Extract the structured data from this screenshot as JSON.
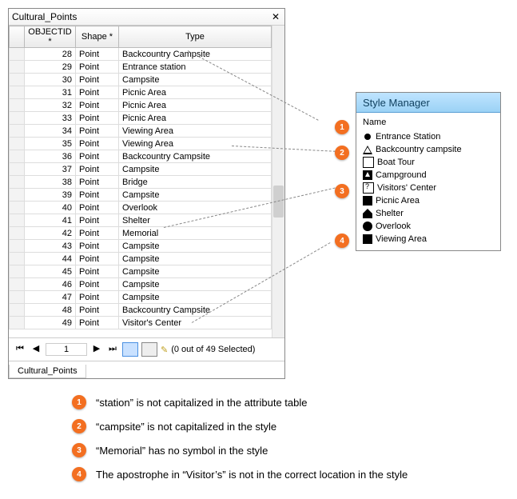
{
  "attrTable": {
    "title": "Cultural_Points",
    "tabLabel": "Cultural_Points",
    "columns": [
      "OBJECTID *",
      "Shape *",
      "Type"
    ],
    "rows": [
      {
        "oid": 28,
        "shape": "Point",
        "type": "Backcountry Campsite"
      },
      {
        "oid": 29,
        "shape": "Point",
        "type": "Entrance station"
      },
      {
        "oid": 30,
        "shape": "Point",
        "type": "Campsite"
      },
      {
        "oid": 31,
        "shape": "Point",
        "type": "Picnic Area"
      },
      {
        "oid": 32,
        "shape": "Point",
        "type": "Picnic Area"
      },
      {
        "oid": 33,
        "shape": "Point",
        "type": "Picnic Area"
      },
      {
        "oid": 34,
        "shape": "Point",
        "type": "Viewing Area"
      },
      {
        "oid": 35,
        "shape": "Point",
        "type": "Viewing Area"
      },
      {
        "oid": 36,
        "shape": "Point",
        "type": "Backcountry Campsite"
      },
      {
        "oid": 37,
        "shape": "Point",
        "type": "Campsite"
      },
      {
        "oid": 38,
        "shape": "Point",
        "type": "Bridge"
      },
      {
        "oid": 39,
        "shape": "Point",
        "type": "Campsite"
      },
      {
        "oid": 40,
        "shape": "Point",
        "type": "Overlook"
      },
      {
        "oid": 41,
        "shape": "Point",
        "type": "Shelter"
      },
      {
        "oid": 42,
        "shape": "Point",
        "type": "Memorial"
      },
      {
        "oid": 43,
        "shape": "Point",
        "type": "Campsite"
      },
      {
        "oid": 44,
        "shape": "Point",
        "type": "Campsite"
      },
      {
        "oid": 45,
        "shape": "Point",
        "type": "Campsite"
      },
      {
        "oid": 46,
        "shape": "Point",
        "type": "Campsite"
      },
      {
        "oid": 47,
        "shape": "Point",
        "type": "Campsite"
      },
      {
        "oid": 48,
        "shape": "Point",
        "type": "Backcountry Campsite"
      },
      {
        "oid": 49,
        "shape": "Point",
        "type": "Visitor's Center"
      }
    ],
    "nav": {
      "first": "⏮",
      "prev": "◀",
      "record": "1",
      "next": "▶",
      "last": "⏭",
      "status": "(0 out of 49 Selected)"
    }
  },
  "styleManager": {
    "title": "Style Manager",
    "header": "Name",
    "items": [
      {
        "sym": "dot",
        "label": "Entrance Station"
      },
      {
        "sym": "tri",
        "label": "Backcountry campsite"
      },
      {
        "sym": "boat",
        "label": "Boat Tour"
      },
      {
        "sym": "sq",
        "label": "Campground"
      },
      {
        "sym": "vc",
        "label": "Visitors' Center"
      },
      {
        "sym": "pic",
        "label": "Picnic Area"
      },
      {
        "sym": "shelter",
        "label": "Shelter"
      },
      {
        "sym": "overlook",
        "label": "Overlook"
      },
      {
        "sym": "view",
        "label": "Viewing Area"
      }
    ]
  },
  "markers": {
    "m1": "1",
    "m2": "2",
    "m3": "3",
    "m4": "4"
  },
  "legend": [
    {
      "num": "1",
      "text": "“station” is not capitalized in the attribute table"
    },
    {
      "num": "2",
      "text": "“campsite” is not capitalized in the style"
    },
    {
      "num": "3",
      "text": "“Memorial” has no symbol in the style"
    },
    {
      "num": "4",
      "text": "The apostrophe in “Visitor’s” is not in the correct location in the style"
    }
  ]
}
